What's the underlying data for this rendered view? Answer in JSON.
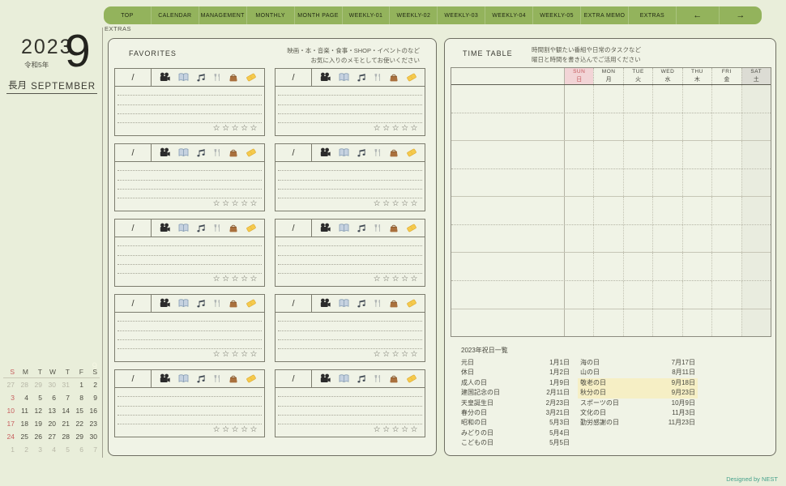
{
  "window": {
    "breadcrumb": "EXTRAS",
    "credit": "Designed by NEST"
  },
  "nav": {
    "tabs": [
      {
        "id": "top",
        "label": "TOP"
      },
      {
        "id": "calendar",
        "label": "CALENDAR"
      },
      {
        "id": "management",
        "label": "MANAGEMENT"
      },
      {
        "id": "monthly",
        "label": "MONTHLY"
      },
      {
        "id": "month-page",
        "label": "MONTH PAGE"
      },
      {
        "id": "weekly-01",
        "label": "WEEKLY-01"
      },
      {
        "id": "weekly-02",
        "label": "WEEKLY-02"
      },
      {
        "id": "weekly-03",
        "label": "WEEKLY-03"
      },
      {
        "id": "weekly-04",
        "label": "WEEKLY-04"
      },
      {
        "id": "weekly-05",
        "label": "WEEKLY-05"
      },
      {
        "id": "extra-memo",
        "label": "EXTRA MEMO"
      },
      {
        "id": "extras",
        "label": "EXTRAS"
      }
    ],
    "prev_arrow": "←",
    "next_arrow": "→"
  },
  "sidebar": {
    "year": "2023",
    "era_label": "令和5年",
    "month_number": "9",
    "month_name_jp": "長月",
    "month_name_en": "SEPTEMBER",
    "mini_calendar": {
      "watermark": "9",
      "weekday_headers": [
        "S",
        "M",
        "T",
        "W",
        "T",
        "F",
        "S"
      ],
      "weeks": [
        [
          {
            "day": "27",
            "style": "out"
          },
          {
            "day": "28",
            "style": "out"
          },
          {
            "day": "29",
            "style": "out"
          },
          {
            "day": "30",
            "style": "out"
          },
          {
            "day": "31",
            "style": "out"
          },
          {
            "day": "1",
            "style": "cur"
          },
          {
            "day": "2",
            "style": "cur"
          }
        ],
        [
          {
            "day": "3",
            "style": "sun"
          },
          {
            "day": "4",
            "style": "cur"
          },
          {
            "day": "5",
            "style": "cur"
          },
          {
            "day": "6",
            "style": "cur"
          },
          {
            "day": "7",
            "style": "cur"
          },
          {
            "day": "8",
            "style": "cur"
          },
          {
            "day": "9",
            "style": "cur"
          }
        ],
        [
          {
            "day": "10",
            "style": "sun"
          },
          {
            "day": "11",
            "style": "cur"
          },
          {
            "day": "12",
            "style": "cur"
          },
          {
            "day": "13",
            "style": "cur"
          },
          {
            "day": "14",
            "style": "cur"
          },
          {
            "day": "15",
            "style": "cur"
          },
          {
            "day": "16",
            "style": "cur"
          }
        ],
        [
          {
            "day": "17",
            "style": "sun"
          },
          {
            "day": "18",
            "style": "cur"
          },
          {
            "day": "19",
            "style": "cur"
          },
          {
            "day": "20",
            "style": "cur"
          },
          {
            "day": "21",
            "style": "cur"
          },
          {
            "day": "22",
            "style": "cur"
          },
          {
            "day": "23",
            "style": "cur"
          }
        ],
        [
          {
            "day": "24",
            "style": "sun"
          },
          {
            "day": "25",
            "style": "cur"
          },
          {
            "day": "26",
            "style": "cur"
          },
          {
            "day": "27",
            "style": "cur"
          },
          {
            "day": "28",
            "style": "cur"
          },
          {
            "day": "29",
            "style": "cur"
          },
          {
            "day": "30",
            "style": "cur"
          }
        ],
        [
          {
            "day": "1",
            "style": "out"
          },
          {
            "day": "2",
            "style": "out"
          },
          {
            "day": "3",
            "style": "out"
          },
          {
            "day": "4",
            "style": "out"
          },
          {
            "day": "5",
            "style": "out"
          },
          {
            "day": "6",
            "style": "out"
          },
          {
            "day": "7",
            "style": "out"
          }
        ]
      ]
    }
  },
  "favorites": {
    "title": "FAVORITES",
    "description_line1": "映画・本・音楽・食事・SHOP・イベントのなど",
    "description_line2": "お気に入りのメモとしてお使いください",
    "card_count": 10,
    "card": {
      "date_placeholder": "/",
      "icons": [
        "movie-camera",
        "open-book",
        "music-notes",
        "fork-and-knife",
        "handbag",
        "ticket"
      ],
      "rating_stars": "☆☆☆☆☆"
    }
  },
  "timetable": {
    "title": "TIME TABLE",
    "description_line1": "時間割や観たい番組や日常のタスクなど",
    "description_line2": "曜日と時間を書き込んでご活用ください",
    "days": [
      {
        "en": "SUN",
        "jp": "日",
        "type": "sun"
      },
      {
        "en": "MON",
        "jp": "月",
        "type": "weekday"
      },
      {
        "en": "TUE",
        "jp": "火",
        "type": "weekday"
      },
      {
        "en": "WED",
        "jp": "水",
        "type": "weekday"
      },
      {
        "en": "THU",
        "jp": "木",
        "type": "weekday"
      },
      {
        "en": "FRI",
        "jp": "金",
        "type": "weekday"
      },
      {
        "en": "SAT",
        "jp": "土",
        "type": "sat"
      }
    ],
    "body_row_count": 9
  },
  "holidays": {
    "title": "2023年祝日一覧",
    "column_left": [
      {
        "name": "元日",
        "date": "1月1日"
      },
      {
        "name": "休日",
        "date": "1月2日"
      },
      {
        "name": "成人の日",
        "date": "1月9日"
      },
      {
        "name": "建国記念の日",
        "date": "2月11日"
      },
      {
        "name": "天皇誕生日",
        "date": "2月23日"
      },
      {
        "name": "春分の日",
        "date": "3月21日"
      },
      {
        "name": "昭和の日",
        "date": "5月3日"
      },
      {
        "name": "みどりの日",
        "date": "5月4日"
      },
      {
        "name": "こどもの日",
        "date": "5月5日"
      }
    ],
    "column_right": [
      {
        "name": "海の日",
        "date": "7月17日",
        "highlight": false
      },
      {
        "name": "山の日",
        "date": "8月11日",
        "highlight": false
      },
      {
        "name": "敬老の日",
        "date": "9月18日",
        "highlight": true
      },
      {
        "name": "秋分の日",
        "date": "9月23日",
        "highlight": true
      },
      {
        "name": "スポーツの日",
        "date": "10月9日",
        "highlight": false
      },
      {
        "name": "文化の日",
        "date": "11月3日",
        "highlight": false
      },
      {
        "name": "勤労感謝の日",
        "date": "11月23日",
        "highlight": false
      }
    ]
  },
  "colors": {
    "page_bg": "#e9eeda",
    "panel_bg": "#f0f3e6",
    "nav_green": "#93b35c",
    "sunday_red": "#c75f5f",
    "sunday_header_bg": "#f2d4d6",
    "saturday_header_bg": "#dcdcd4",
    "holiday_highlight": "#f6efc5",
    "credit_teal": "#46a18c"
  }
}
